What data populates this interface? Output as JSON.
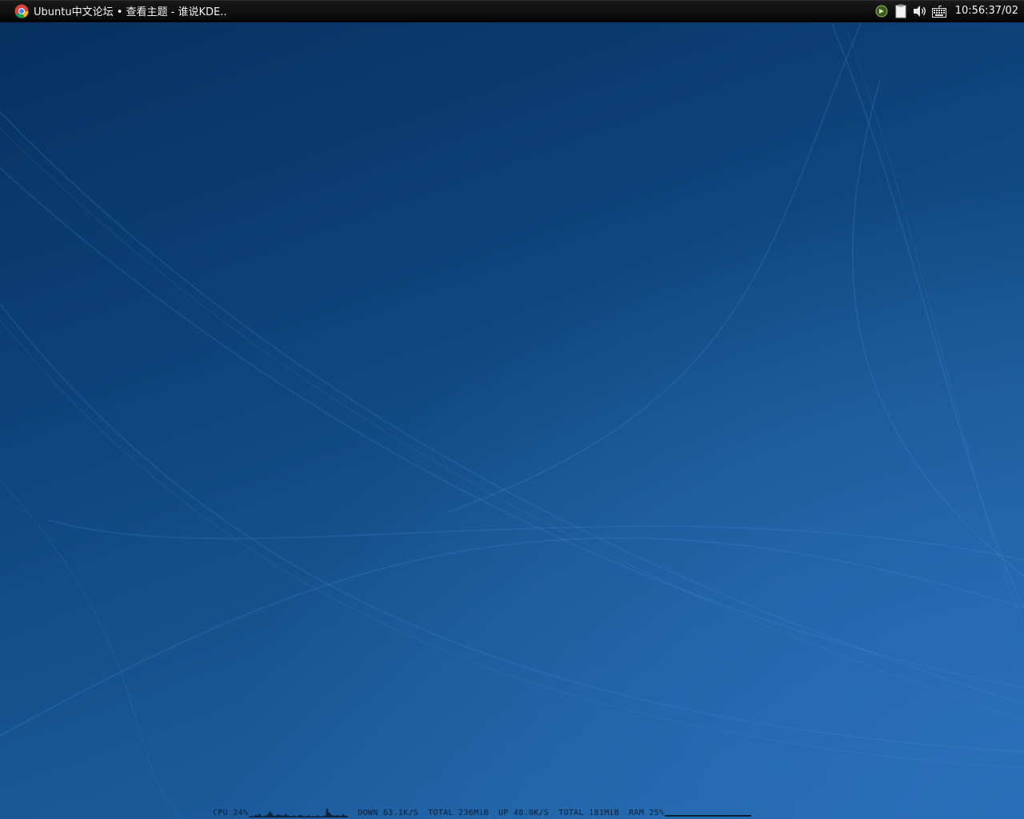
{
  "panel": {
    "window_title": "Ubuntu中文论坛 • 查看主题 - 谁说KDE...",
    "app_icon": "chrome-browser-icon",
    "tray_icons": [
      "network-manager-icon",
      "clipboard-icon",
      "volume-icon",
      "keyboard-layout-icon"
    ],
    "clock": "10:56:37/02"
  },
  "sysmon": {
    "cpu": "CPU 24%",
    "down": "DOWN 63.1K/S",
    "down_total": "TOTAL 236MiB",
    "up": "UP 48.0K/S",
    "up_total": "TOTAL 181MiB",
    "ram": "RAM 25%",
    "ram_fraction": 0.25,
    "cpu_history": [
      0.1,
      0.15,
      0.1,
      0.25,
      0.2,
      0.35,
      0.15,
      0.1,
      0.2,
      0.3,
      0.6,
      0.4,
      0.2,
      0.15,
      0.3,
      0.25,
      0.2,
      0.15,
      0.35,
      0.2,
      0.15,
      0.1,
      0.2,
      0.15,
      0.1,
      0.25,
      0.2,
      0.15,
      0.1,
      0.15,
      0.2,
      0.1,
      0.15,
      0.1,
      0.2,
      0.15,
      0.1,
      0.15,
      0.2,
      0.9,
      0.5,
      0.3,
      0.2,
      0.15,
      0.25,
      0.2,
      0.15,
      0.3,
      0.2,
      0.15
    ]
  },
  "colors": {
    "panel_bg": "#0a0a0a",
    "wallpaper_dark": "#06305e",
    "wallpaper_light": "#2a70b8",
    "sysmon_text": "#0b1f35"
  }
}
